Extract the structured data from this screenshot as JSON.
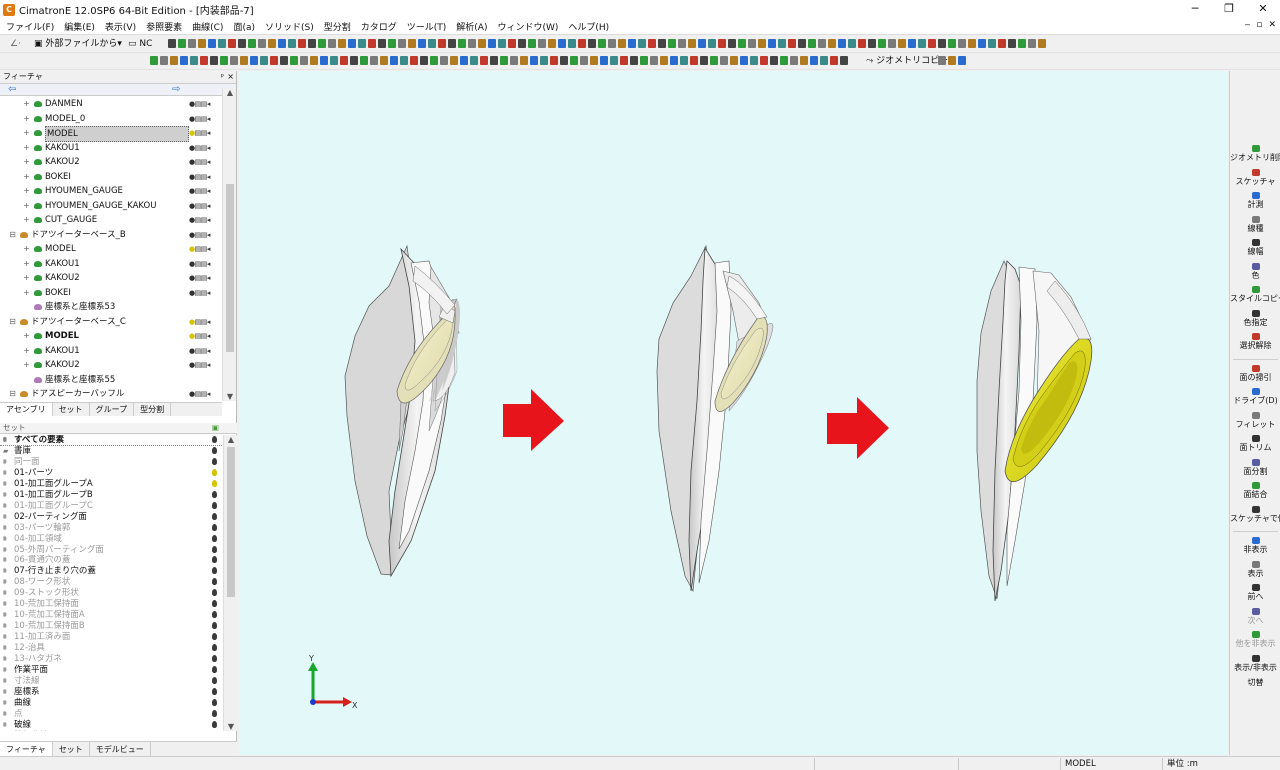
{
  "window": {
    "app_icon": "cimatron-app-icon",
    "title": "CimatronE 12.0SP6  64-Bit Edition - [内装部品-7]",
    "minimize": "─",
    "maximize": "❐",
    "close": "✕"
  },
  "menu": {
    "items": [
      "ファイル(F)",
      "編集(E)",
      "表示(V)",
      "参照要素",
      "曲線(C)",
      "面(a)",
      "ソリッド(S)",
      "型分割",
      "カタログ",
      "ツール(T)",
      "解析(A)",
      "ウィンドウ(W)",
      "ヘルプ(H)"
    ],
    "mdi_minimize": "‒",
    "mdi_restore": "▫",
    "mdi_close": "✕"
  },
  "toolbar": {
    "import_label": "外部ファイルから",
    "nc_label": "NC",
    "geometry_copy_label": "ジオメトリコピー"
  },
  "feature_pane": {
    "title": "フィーチャ",
    "pin_icon": "pin-icon",
    "close": "×",
    "back_arrow": "⇦",
    "forward_arrow": "⇨",
    "tree": [
      {
        "label": "DANMEN",
        "indent": 2,
        "type": "layer",
        "bold": false,
        "selected": false,
        "bulb": "black"
      },
      {
        "label": "MODEL_0",
        "indent": 2,
        "type": "layer",
        "bold": false,
        "selected": false,
        "bulb": "black"
      },
      {
        "label": "MODEL",
        "indent": 2,
        "type": "layer",
        "bold": false,
        "selected": true,
        "bulb": "yellow"
      },
      {
        "label": "KAKOU1",
        "indent": 2,
        "type": "layer",
        "bold": false,
        "selected": false,
        "bulb": "black"
      },
      {
        "label": "KAKOU2",
        "indent": 2,
        "type": "layer",
        "bold": false,
        "selected": false,
        "bulb": "black"
      },
      {
        "label": "BOKEI",
        "indent": 2,
        "type": "layer",
        "bold": false,
        "selected": false,
        "bulb": "black"
      },
      {
        "label": "HYOUMEN_GAUGE",
        "indent": 2,
        "type": "layer",
        "bold": false,
        "selected": false,
        "bulb": "black"
      },
      {
        "label": "HYOUMEN_GAUGE_KAKOU",
        "indent": 2,
        "type": "layer",
        "bold": false,
        "selected": false,
        "bulb": "black"
      },
      {
        "label": "CUT_GAUGE",
        "indent": 2,
        "type": "layer",
        "bold": false,
        "selected": false,
        "bulb": "black"
      },
      {
        "label": "ドアツイーターベース_B",
        "indent": 1,
        "type": "part",
        "bold": false,
        "selected": false,
        "bulb": "black"
      },
      {
        "label": "MODEL",
        "indent": 2,
        "type": "layer",
        "bold": false,
        "selected": false,
        "bulb": "yellow"
      },
      {
        "label": "KAKOU1",
        "indent": 2,
        "type": "layer",
        "bold": false,
        "selected": false,
        "bulb": "black"
      },
      {
        "label": "KAKOU2",
        "indent": 2,
        "type": "layer",
        "bold": false,
        "selected": false,
        "bulb": "black"
      },
      {
        "label": "BOKEI",
        "indent": 2,
        "type": "layer",
        "bold": false,
        "selected": false,
        "bulb": "black"
      },
      {
        "label": "座標系と座標系53",
        "indent": 2,
        "type": "coord",
        "bold": false,
        "selected": false,
        "bulb": "none"
      },
      {
        "label": "ドアツイーターベース_C",
        "indent": 1,
        "type": "part",
        "bold": false,
        "selected": false,
        "bulb": "yellow"
      },
      {
        "label": "MODEL",
        "indent": 2,
        "type": "layer",
        "bold": true,
        "selected": false,
        "bulb": "yellow"
      },
      {
        "label": "KAKOU1",
        "indent": 2,
        "type": "layer",
        "bold": false,
        "selected": false,
        "bulb": "black"
      },
      {
        "label": "KAKOU2",
        "indent": 2,
        "type": "layer",
        "bold": false,
        "selected": false,
        "bulb": "black"
      },
      {
        "label": "座標系と座標系55",
        "indent": 2,
        "type": "coord",
        "bold": false,
        "selected": false,
        "bulb": "none"
      },
      {
        "label": "ドアスピーカーバッフル",
        "indent": 1,
        "type": "part",
        "bold": false,
        "selected": false,
        "bulb": "black"
      }
    ],
    "tabs": [
      "アセンブリ",
      "セット",
      "グループ",
      "型分割"
    ],
    "active_tab": 0
  },
  "set_pane": {
    "header": "セット",
    "items": [
      {
        "label": "すべての要素",
        "dim": false,
        "bulb": "black"
      },
      {
        "label": "書庫",
        "dim": false,
        "bulb": "black"
      },
      {
        "label": "同一面",
        "dim": true,
        "bulb": "black"
      },
      {
        "label": "01-パーツ",
        "dim": false,
        "bulb": "yellow"
      },
      {
        "label": "01-加工面グループA",
        "dim": false,
        "bulb": "yellow"
      },
      {
        "label": "01-加工面グループB",
        "dim": false,
        "bulb": "black"
      },
      {
        "label": "01-加工面グループC",
        "dim": true,
        "bulb": "black"
      },
      {
        "label": "02-パーティング面",
        "dim": false,
        "bulb": "black"
      },
      {
        "label": "03-パーツ輪郭",
        "dim": true,
        "bulb": "black"
      },
      {
        "label": "04-加工領域",
        "dim": true,
        "bulb": "black"
      },
      {
        "label": "05-外周パーティング面",
        "dim": true,
        "bulb": "black"
      },
      {
        "label": "06-貫通穴の蓋",
        "dim": true,
        "bulb": "black"
      },
      {
        "label": "07-行き止まり穴の蓋",
        "dim": false,
        "bulb": "black"
      },
      {
        "label": "08-ワーク形状",
        "dim": true,
        "bulb": "black"
      },
      {
        "label": "09-ストック形状",
        "dim": true,
        "bulb": "black"
      },
      {
        "label": "10-荒加工保持面",
        "dim": true,
        "bulb": "black"
      },
      {
        "label": "10-荒加工保持面A",
        "dim": true,
        "bulb": "black"
      },
      {
        "label": "10-荒加工保持面B",
        "dim": true,
        "bulb": "black"
      },
      {
        "label": "11-加工済み面",
        "dim": true,
        "bulb": "black"
      },
      {
        "label": "12-治具",
        "dim": true,
        "bulb": "black"
      },
      {
        "label": "13-ハタガネ",
        "dim": true,
        "bulb": "black"
      },
      {
        "label": "作業平面",
        "dim": false,
        "bulb": "black"
      },
      {
        "label": "寸法線",
        "dim": true,
        "bulb": "black"
      },
      {
        "label": "座標系",
        "dim": false,
        "bulb": "black"
      },
      {
        "label": "曲線",
        "dim": false,
        "bulb": "black"
      },
      {
        "label": "点",
        "dim": true,
        "bulb": "black"
      },
      {
        "label": "破線",
        "dim": false,
        "bulb": "black"
      },
      {
        "label": "輪郭曲線",
        "dim": false,
        "bulb": "black"
      }
    ]
  },
  "bottom_tabs": [
    "フィーチャ",
    "セット",
    "モデルビュー"
  ],
  "viewport": {
    "background": "#e2f8f9",
    "axis_y": "Y",
    "axis_x": "X",
    "arrow_color": "#e8141b",
    "highlight_color": "#e6e222"
  },
  "right_panel": {
    "groups": [
      [
        {
          "label": "ジオメトリ削除",
          "dim": false
        },
        {
          "label": "スケッチャ",
          "dim": false
        },
        {
          "label": "計測",
          "dim": false
        },
        {
          "label": "線種",
          "dim": false
        },
        {
          "label": "線幅",
          "dim": false
        },
        {
          "label": "色",
          "dim": false
        },
        {
          "label": "スタイルコピー",
          "dim": false
        },
        {
          "label": "色指定",
          "dim": false
        },
        {
          "label": "選択解除",
          "dim": false
        }
      ],
      [
        {
          "label": "面の掃引",
          "dim": false
        },
        {
          "label": "ドライブ(D)",
          "dim": false
        },
        {
          "label": "フィレット",
          "dim": false
        },
        {
          "label": "面トリム",
          "dim": false
        },
        {
          "label": "面分割",
          "dim": false
        },
        {
          "label": "面結合",
          "dim": false
        },
        {
          "label": "スケッチャで修正",
          "dim": false
        }
      ],
      [
        {
          "label": "非表示",
          "dim": false
        },
        {
          "label": "表示",
          "dim": false
        },
        {
          "label": "前へ",
          "dim": false
        },
        {
          "label": "次へ",
          "dim": true
        },
        {
          "label": "他を非表示",
          "dim": true
        },
        {
          "label": "表示/非表示",
          "dim": false
        },
        {
          "label": "切替",
          "dim": false
        }
      ]
    ]
  },
  "status": {
    "model": "MODEL",
    "unit": "単位 :m"
  }
}
